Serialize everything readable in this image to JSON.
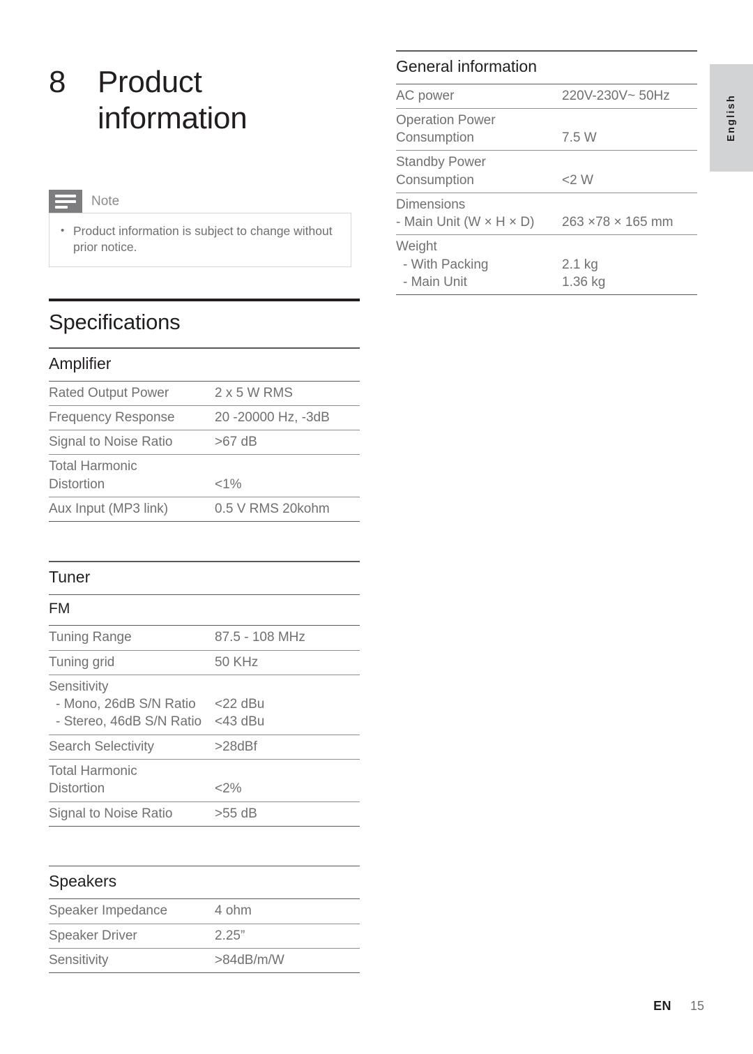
{
  "language_tab": {
    "label": "English"
  },
  "chapter": {
    "number": "8",
    "title_line1": "Product",
    "title_line2": "information"
  },
  "note": {
    "label": "Note",
    "icon": "note-lines-icon",
    "bullet": "•",
    "text": "Product information is subject to change without prior notice."
  },
  "specifications": {
    "heading": "Specifications",
    "sections": [
      {
        "heading": "Amplifier",
        "rows": [
          {
            "key": "Rated Output Power",
            "value": "2 x 5 W RMS"
          },
          {
            "key": "Frequency Response",
            "value": "20 -20000 Hz, -3dB"
          },
          {
            "key": "Signal to Noise Ratio",
            "value": ">67 dB"
          },
          {
            "key": "Total Harmonic",
            "key2": "Distortion",
            "value": "",
            "value2": "<1%"
          },
          {
            "key": "Aux Input (MP3 link)",
            "value": "0.5 V RMS 20kohm"
          }
        ]
      },
      {
        "heading": "Tuner",
        "subheading": "FM",
        "rows": [
          {
            "key": "Tuning Range",
            "value": "87.5 - 108 MHz"
          },
          {
            "key": "Tuning grid",
            "value": "50 KHz"
          },
          {
            "key": "Sensitivity",
            "sub": [
              {
                "key": "- Mono, 26dB S/N Ratio",
                "value": "<22 dBu"
              },
              {
                "key": "- Stereo, 46dB S/N Ratio",
                "value": "<43 dBu"
              }
            ]
          },
          {
            "key": "Search Selectivity",
            "value": ">28dBf"
          },
          {
            "key": "Total Harmonic",
            "key2": "Distortion",
            "value": "",
            "value2": "<2%"
          },
          {
            "key": "Signal to Noise Ratio",
            "value": ">55 dB"
          }
        ]
      },
      {
        "heading": "Speakers",
        "rows": [
          {
            "key": "Speaker Impedance",
            "value": "4 ohm"
          },
          {
            "key": "Speaker Driver",
            "value": "2.25”"
          },
          {
            "key": "Sensitivity",
            "value": ">84dB/m/W"
          }
        ]
      }
    ]
  },
  "general_information": {
    "heading": "General information",
    "rows": [
      {
        "key": "AC power",
        "value": "220V-230V~ 50Hz"
      },
      {
        "key": "Operation Power",
        "key2": "Consumption",
        "value": "",
        "value2": "7.5 W"
      },
      {
        "key": "Standby Power",
        "key2": "Consumption",
        "value": "",
        "value2": "<2 W"
      },
      {
        "key": "Dimensions",
        "sub": [
          {
            "key": "- Main Unit (W × H × D)",
            "value": "263 ×78 × 165 mm"
          }
        ]
      },
      {
        "key": "Weight",
        "sub": [
          {
            "key": "- With Packing",
            "value": "2.1 kg"
          },
          {
            "key": "- Main Unit",
            "value": "1.36 kg"
          }
        ]
      }
    ]
  },
  "footer": {
    "lang_code": "EN",
    "page_number": "15"
  }
}
